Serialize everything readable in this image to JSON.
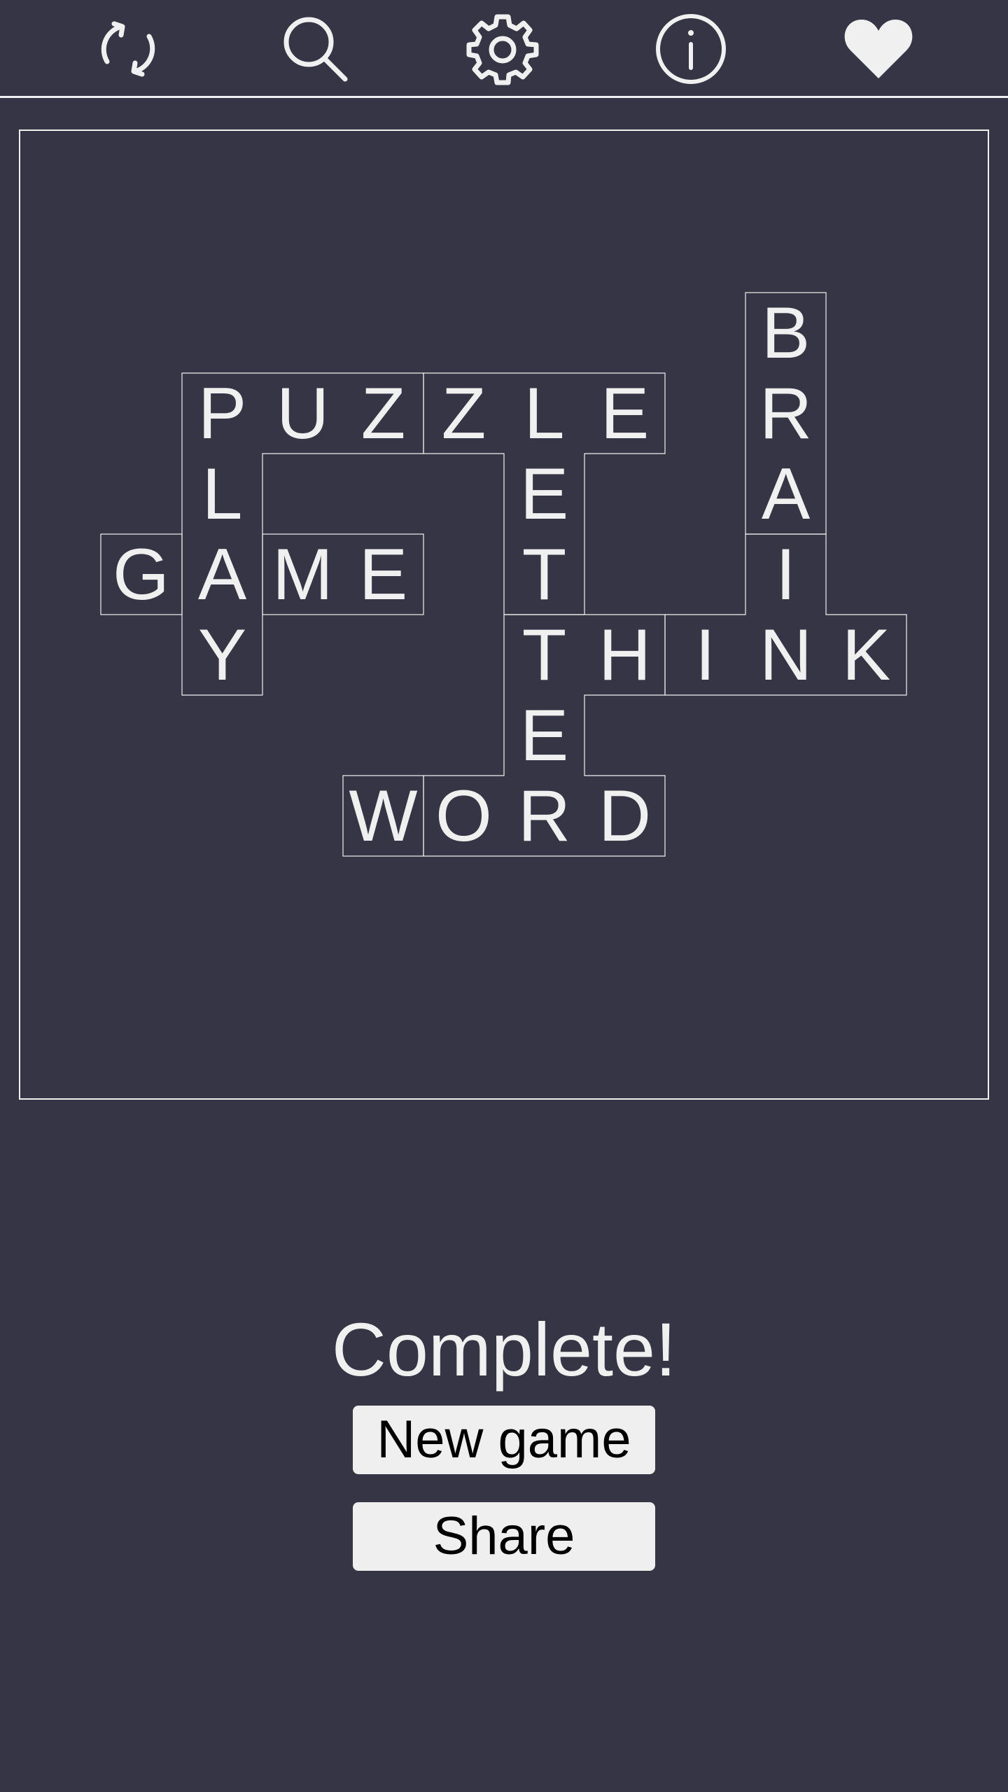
{
  "toolbar": {
    "icons": [
      "refresh-icon",
      "search-icon",
      "settings-icon",
      "info-icon",
      "heart-icon"
    ]
  },
  "colors": {
    "background": "#363545",
    "foreground": "#f0f0f0",
    "button": "#efefef",
    "button_text": "#000000"
  },
  "board": {
    "tiles": [
      "P",
      "U",
      "Z",
      "Z",
      "L",
      "E",
      "L",
      "A",
      "Y",
      "G",
      "M",
      "E",
      "B",
      "R",
      "A",
      "I",
      "N",
      "K",
      "E",
      "T",
      "T",
      "E",
      "R",
      "H",
      "I",
      "W",
      "O",
      "D"
    ]
  },
  "status": {
    "message": "Complete!"
  },
  "actions": {
    "new_game_label": "New game",
    "share_label": "Share"
  }
}
